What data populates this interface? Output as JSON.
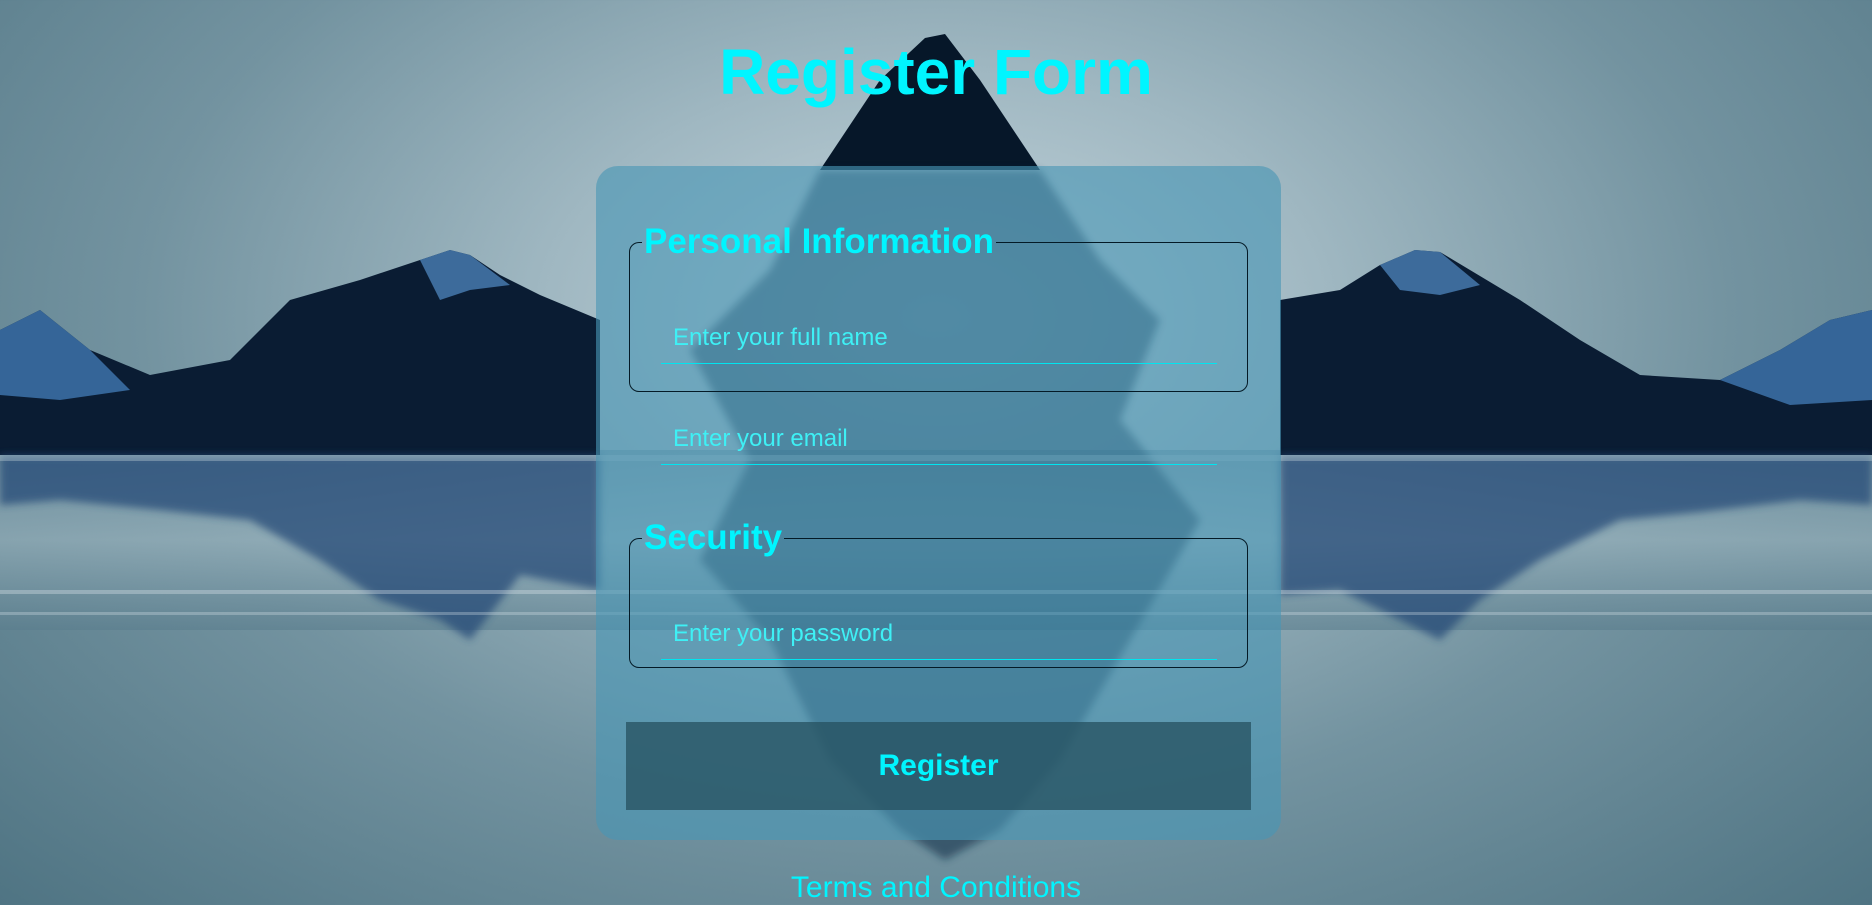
{
  "page": {
    "title": "Register Form"
  },
  "form": {
    "personal": {
      "legend": "Personal Information",
      "name_placeholder": "Enter your full name",
      "email_placeholder": "Enter your email"
    },
    "security": {
      "legend": "Security",
      "password_placeholder": "Enter your password"
    },
    "submit_label": "Register"
  },
  "footer": {
    "terms_label": "Terms and Conditions"
  },
  "colors": {
    "accent": "#00f5ff",
    "card": "#4896b4",
    "button": "#26505f",
    "mountain_dark": "#061729",
    "mountain_blue": "#3c6fa8"
  }
}
